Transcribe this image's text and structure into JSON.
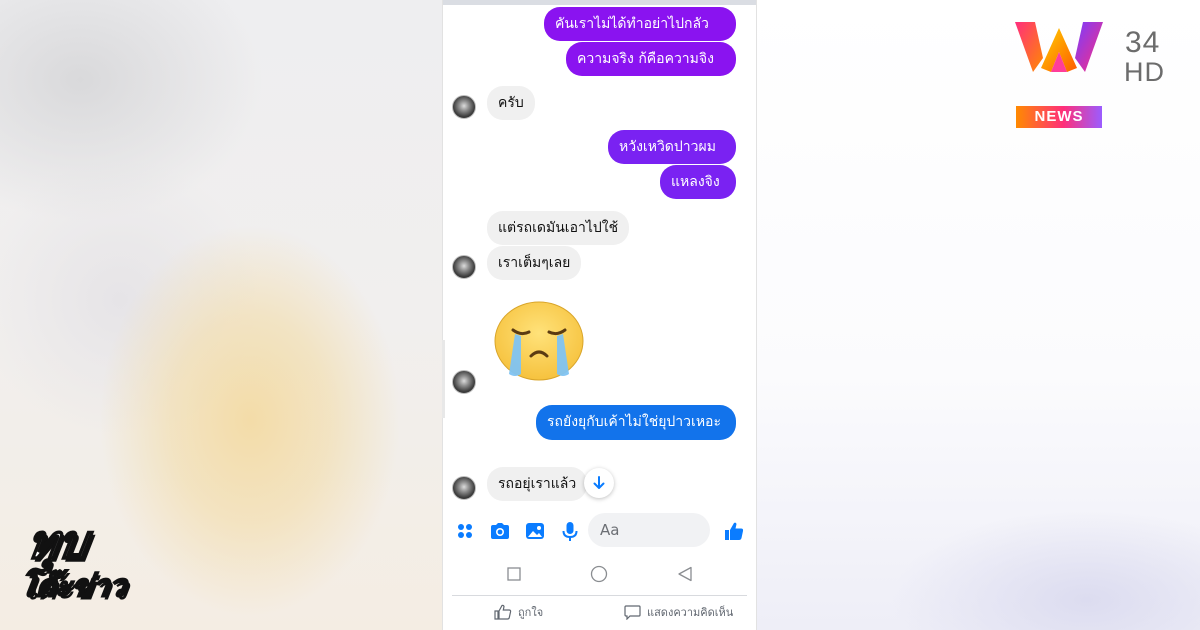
{
  "messages": {
    "sent1": "คันเราไม่ได้ทำอย่าไปกลัว",
    "sent2": "ความจริง ก้คือความจิง",
    "recv1": "ครับ",
    "sent3": "หวังเหวิดปาวผม",
    "sent4": "แหลงจิง",
    "recv2": "แต่รถเดมันเอาไปใช้",
    "recv3": "เราเต็มๆเลย",
    "sent5": "รถยังยุกับเค้าไม่ใช่ยุปาวเหอะ",
    "recv4": "รถอยุ่เราแล้ว"
  },
  "composer": {
    "placeholder": "Aa"
  },
  "facebook_actions": {
    "like": "ถูกใจ",
    "comment": "แสดงความคิดเห็น"
  },
  "brand": {
    "channel_number": "34",
    "channel_hd": "HD",
    "news_label": "NEWS"
  },
  "show_logo": {
    "line1": "ทุบ",
    "line2": "โต๊ะข่าว"
  },
  "icons": {
    "apps": "grid-dots-icon",
    "camera": "camera-icon",
    "gallery": "image-icon",
    "mic": "microphone-icon",
    "emoji": "smiley-icon",
    "like": "thumbs-up-icon",
    "scroll": "arrow-down-icon",
    "crying": "crying-face-emoji"
  },
  "colors": {
    "sent_purple": "#8a13f0",
    "sent_violet": "#7a22f2",
    "sent_blue": "#1273eb",
    "received": "#f0f0f0",
    "messenger_blue": "#0a7cff"
  }
}
